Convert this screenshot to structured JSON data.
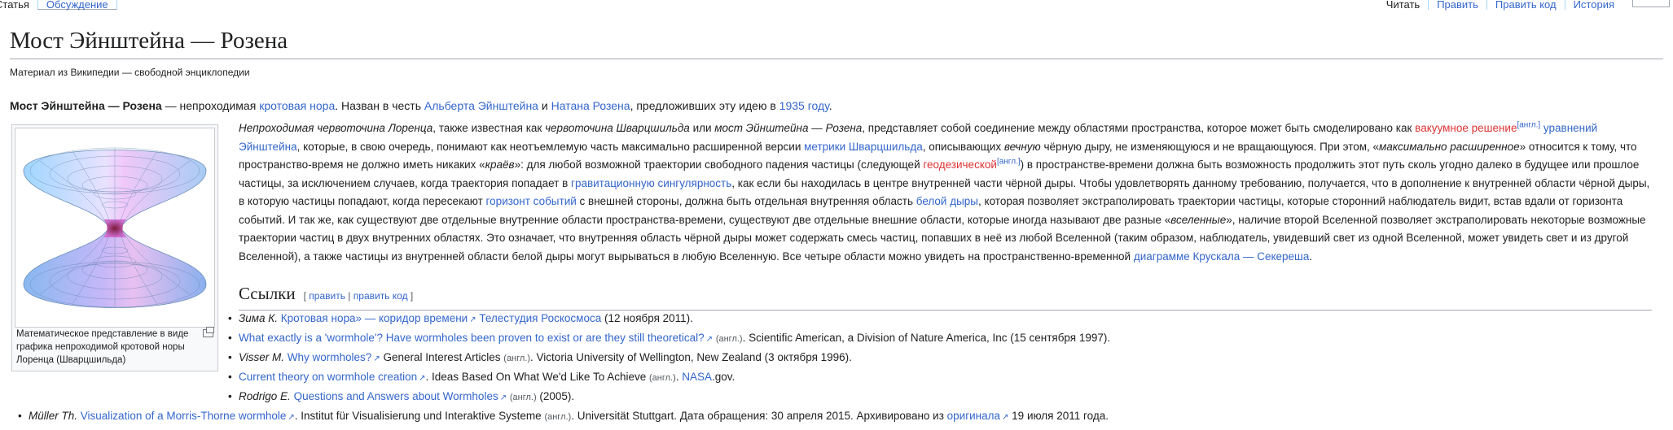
{
  "tabs_left": [
    {
      "label": "Статья",
      "selected": true
    },
    {
      "label": "Обсуждение",
      "selected": false
    }
  ],
  "tabs_right": [
    {
      "label": "Читать",
      "selected": true
    },
    {
      "label": "Править",
      "selected": false
    },
    {
      "label": "Править код",
      "selected": false
    },
    {
      "label": "История",
      "selected": false
    }
  ],
  "title": "Мост Эйнштейна — Розена",
  "tagline": "Материал из Википедии — свободной энциклопедии",
  "lead": {
    "bold": "Мост Эйнштейна — Розена",
    "t1": " — непроходимая ",
    "link1": "кротовая нора",
    "t2": ". Назван в честь ",
    "link2": "Альберта Эйнштейна",
    "t3": " и ",
    "link3": "Натана Розена",
    "t4": ", предложивших эту идею в ",
    "link4": "1935 году",
    "t5": "."
  },
  "thumb_caption": "Математическое представление в виде графика непроходимой кротовой норы Лоренца (Шварцшильда)",
  "body": {
    "s1_i": "Непроходимая червоточина Лоренца",
    "s1": ", также известная как ",
    "s2_i": "червоточина Шварцшильда",
    "s3": " или ",
    "s4_i": "мост Эйнштейна — Розена",
    "s5": ", представляет собой соединение между областями пространства, которое может быть смоделировано как ",
    "l_vac": "вакуумное решение",
    "sup_en": "[англ.]",
    "s6": " ",
    "l_eq": "уравнений Эйнштейна",
    "s7": ", которые, в свою очередь, понимают как неотъемлемую часть максимально расширенной версии ",
    "l_metric": "метрики Шварцшильда",
    "s8": ", описывающих ",
    "s9_i": "вечную",
    "s10": " чёрную дыру, не изменяющуюся и не вращающуюся. При этом, «",
    "s11_i": "максимально расширенное",
    "s12": "» относится к тому, что пространство-время не должно иметь никаких «",
    "s13_i": "краёв",
    "s14": "»: для любой возможной траектории свободного падения частицы (следующей ",
    "l_geo": "геодезической",
    "sup_en2": "[англ.]",
    "s15": ") в пространстве-времени должна быть возможность продолжить этот путь сколь угодно далеко в будущее или прошлое частицы, за исключением случаев, когда траектория попадает в ",
    "l_sing": "гравитационную сингулярность",
    "s16": ", как если бы находилась в центре внутренней части чёрной дыры. Чтобы удовлетворять данному требованию, получается, что в дополнение к внутренней области чёрной дыры, в которую частицы попадают, когда пересекают ",
    "l_horizon": "горизонт событий",
    "s17": " с внешней стороны, должна быть отдельная внутренняя область ",
    "l_white": "белой дыры",
    "s18": ", которая позволяет экстраполировать траектории частицы, которые сторонний наблюдатель видит, встав вдали от горизонта событий. И так же, как существуют две отдельные внутренние области пространства-времени, существуют две отдельные внешние области, которые иногда называют две разные «",
    "s19_i": "вселенные",
    "s20": "», наличие второй Вселенной позволяет экстраполировать некоторые возможные траектории частиц в двух внутренних областях. Это означает, что внутренняя область чёрной дыры может содержать смесь частиц, попавших в неё из любой Вселенной (таким образом, наблюдатель, увидевший свет из одной Вселенной, может увидеть свет и из другой Вселенной), а также частицы из внутренней области белой дыры могут вырываться в любую Вселенную. Все четыре области можно увидеть на пространственно-временной ",
    "l_kruskal": "диаграмме Крускала — Секереша",
    "s21": "."
  },
  "refs_heading": "Ссылки",
  "edit_links": {
    "open": "[ ",
    "edit": "править",
    "sep": " | ",
    "edit_code": "править код",
    "close": " ]"
  },
  "refs": [
    {
      "author": "Зима К.",
      "title": "Кротовая нора» — коридор времени",
      "rest_link": "Телестудия Роскосмоса",
      "rest": " (12 ноября 2011)."
    },
    {
      "title": "What exactly is a 'wormhole'? Have wormholes been proven to exist or are they still theoretical?",
      "lang": "(англ.)",
      "rest": ". Scientific American, a Division of Nature America, Inc (15 сентября 1997)."
    },
    {
      "author": "Visser M.",
      "title": "Why wormholes?",
      "rest": " General Interest Articles ",
      "lang": "(англ.)",
      "rest2": ". Victoria University of Wellington, New Zealand (3 октября 1996)."
    },
    {
      "title": "Current theory on wormhole creation",
      "rest": ". Ideas Based On What We'd Like To Achieve ",
      "lang": "(англ.)",
      "rest_link": "NASA",
      "rest2": ".gov."
    },
    {
      "author": "Rodrigo E.",
      "title": "Questions and Answers about Wormholes",
      "lang": "(англ.)",
      "rest": " (2005)."
    }
  ],
  "last_ref": {
    "author": "Müller Th.",
    "title": "Visualization of a Morris-Thorne wormhole",
    "rest": ". Institut für Visualisierung und Interaktive Systeme ",
    "lang": "(англ.)",
    "rest2": ". Universität Stuttgart. Дата обращения: 30 апреля 2015. Архивировано из ",
    "link": "оригинала",
    "rest3": " 19 июля 2011 года."
  },
  "colors": {
    "link": "#3366cc",
    "redlink": "#d33",
    "text": "#202122",
    "border": "#a2a9b1"
  }
}
